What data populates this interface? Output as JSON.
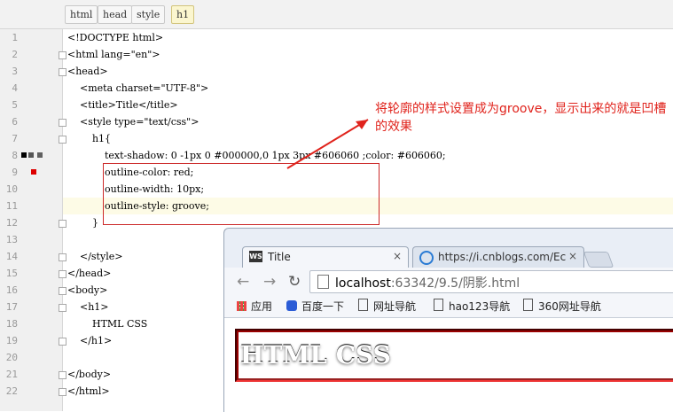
{
  "breadcrumb": [
    "html",
    "head",
    "style",
    "h1"
  ],
  "editor": {
    "lines": [
      {
        "n": "1",
        "code": "<!DOCTYPE html>"
      },
      {
        "n": "2",
        "code": "<html lang=\"en\">"
      },
      {
        "n": "3",
        "code": "<head>"
      },
      {
        "n": "4",
        "code": "    <meta charset=\"UTF-8\">"
      },
      {
        "n": "5",
        "code": "    <title>Title</title>"
      },
      {
        "n": "6",
        "code": "    <style type=\"text/css\">"
      },
      {
        "n": "7",
        "code": "        h1{"
      },
      {
        "n": "8",
        "code": "            text-shadow: 0 -1px 0 #000000,0 1px 3px #606060 ;color: #606060;"
      },
      {
        "n": "9",
        "code": "            outline-color: red;"
      },
      {
        "n": "10",
        "code": "            outline-width: 10px;"
      },
      {
        "n": "11",
        "code": "            outline-style: groove;"
      },
      {
        "n": "12",
        "code": "        }"
      },
      {
        "n": "13",
        "code": ""
      },
      {
        "n": "14",
        "code": "    </style>"
      },
      {
        "n": "15",
        "code": "</head>"
      },
      {
        "n": "16",
        "code": "<body>"
      },
      {
        "n": "17",
        "code": "    <h1>"
      },
      {
        "n": "18",
        "code": "        HTML CSS"
      },
      {
        "n": "19",
        "code": "    </h1>"
      },
      {
        "n": "20",
        "code": ""
      },
      {
        "n": "21",
        "code": "</body>"
      },
      {
        "n": "22",
        "code": "</html>"
      }
    ]
  },
  "annotation": "将轮廓的样式设置成为groove，显示出来的就是凹槽的效果",
  "browser": {
    "tabs": [
      {
        "label": "Title",
        "close": "×"
      },
      {
        "label": "https://i.cnblogs.com/Ec",
        "close": "×"
      }
    ],
    "url_host": "localhost",
    "url_rest": ":63342/9.5/阴影.html",
    "bookmarks": [
      "应用",
      "百度一下",
      "网址导航",
      "hao123导航",
      "360网址导航"
    ],
    "page_heading": "HTML CSS"
  },
  "colors": {
    "annotation": "#e0231c",
    "outline": "#cc0000",
    "gutter": "#f0f0f0"
  }
}
